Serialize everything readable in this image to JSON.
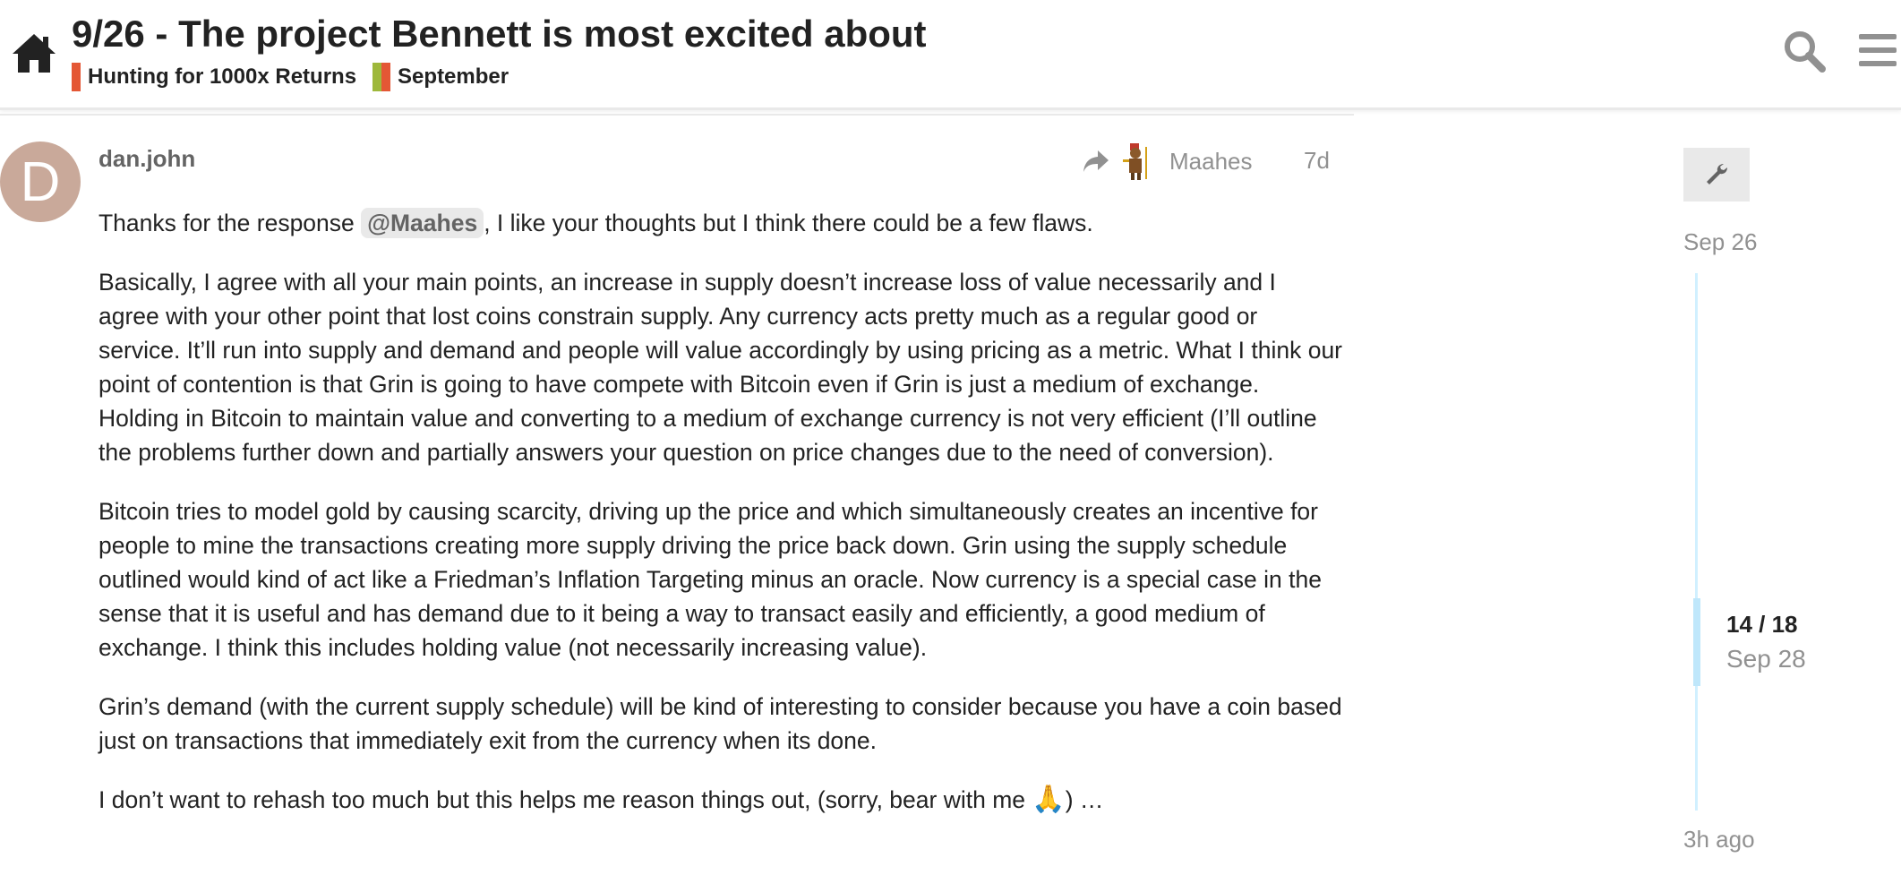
{
  "header": {
    "title": "9/26 - The project Bennett is most excited about",
    "categories": [
      {
        "label": "Hunting for 1000x Returns",
        "colors": [
          "#e45735"
        ]
      },
      {
        "label": "September",
        "colors": [
          "#9eb83b",
          "#e45735"
        ]
      }
    ],
    "icons": {
      "home": "home-icon",
      "search": "search-icon",
      "menu": "hamburger-menu-icon"
    }
  },
  "post": {
    "avatar_letter": "D",
    "avatar_color": "#c9a99a",
    "username": "dan.john",
    "reply_to": "Maahes",
    "age": "7d",
    "paragraphs": {
      "p1_before": "Thanks for the response ",
      "mention": "@Maahes",
      "p1_after": ", I like your thoughts but I think there could be a few flaws.",
      "p2": "Basically, I agree with all your main points, an increase in supply doesn’t increase loss of value necessarily and I agree with your other point that lost coins constrain supply. Any currency acts pretty much as a regular good or service. It’ll run into supply and demand and people will value accordingly by using pricing as a metric. What I think our point of contention is that Grin is going to have compete with Bitcoin even if Grin is just a medium of exchange. Holding in Bitcoin to maintain value and converting to a medium of exchange currency is not very efficient (I’ll outline the problems further down and partially answers your question on price changes due to the need of conversion).",
      "p3": "Bitcoin tries to model gold by causing scarcity, driving up the price and which simultaneously creates an incentive for people to mine the transactions creating more supply driving the price back down. Grin using the supply schedule outlined would kind of act like a Friedman’s Inflation Targeting minus an oracle. Now currency is a special case in the sense that it is useful and has demand due to it being a way to transact easily and efficiently, a good medium of exchange. I think this includes holding value (not necessarily increasing value).",
      "p4": "Grin’s demand (with the current supply schedule) will be kind of interesting to consider because you have a coin based just on transactions that immediately exit from the currency when its done.",
      "p5_before": "I don’t want to rehash too much but this helps me reason things out, (sorry, bear with me ",
      "emoji": "🙏",
      "p5_after": ") …"
    }
  },
  "timeline": {
    "start_date": "Sep 26",
    "position": "14 / 18",
    "position_date": "Sep 28",
    "end_label": "3h ago",
    "progress_fraction": 0.778
  },
  "colors": {
    "accent_track": "#d1f0ff",
    "muted_text": "#919191",
    "category_red": "#e45735",
    "category_green": "#9eb83b"
  }
}
